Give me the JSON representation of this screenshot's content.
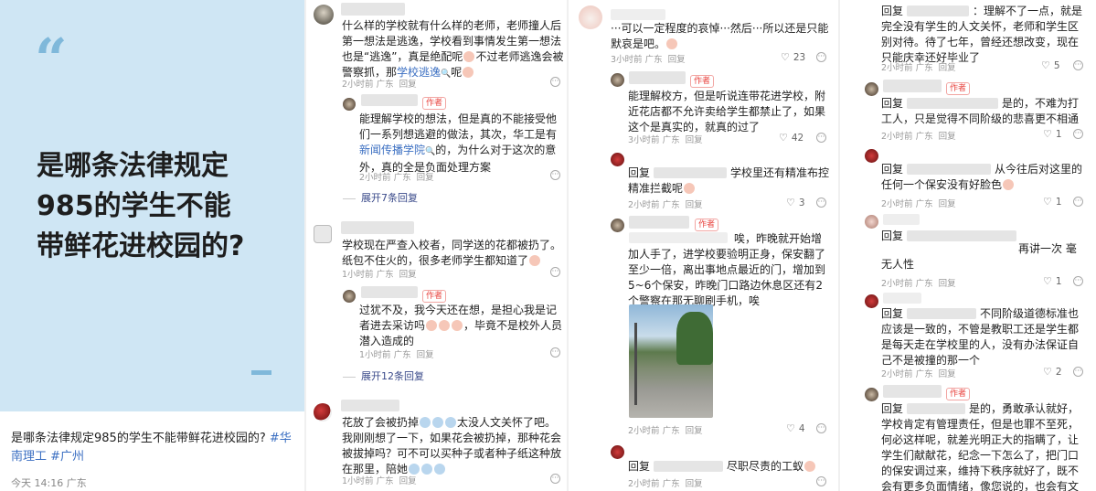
{
  "post": {
    "quote_mark": "“",
    "title_lines": [
      "是哪条法律规定",
      "985的学生不能",
      "带鲜花进校园的?"
    ],
    "caption_text": "是哪条法律规定985的学生不能带鲜花进校园的? ",
    "caption_tags": "#华南理工 #广州",
    "meta": "今天 14:16 广东"
  },
  "common": {
    "author_tag": "作者",
    "reply": "回复",
    "reply_prefix": "回复"
  },
  "col1": {
    "c1": {
      "text_a": "什么样的学校就有什么样的老师，老师撞人后第一想法是逃逸，学校看到事情发生第一想法也是“逃逸”，真是绝配呢",
      "text_b": "不过老师逃逸会被警察抓，那",
      "link": "学校逃逸",
      "link_icon": "🔍",
      "text_c": "呢",
      "meta": "2小时前 广东",
      "reply": "回复"
    },
    "c1r": {
      "text_a": "能理解学校的想法，但是真的不能接受他们一系列想逃避的做法，其次，华工是有",
      "link": "新闻传播学院",
      "link_icon": "🔍",
      "text_b": "的，为什么对于这次的意外，真的全是负面处理方案",
      "meta": "2小时前 广东",
      "reply": "回复"
    },
    "expand1": "展开7条回复",
    "c2": {
      "text": "学校现在严查入校者，同学送的花都被扔了。纸包不住火的，很多老师学生都知道了",
      "meta": "1小时前 广东",
      "reply": "回复"
    },
    "c2r": {
      "text_a": "过犹不及，我今天还在想，是担心我是记者进去采访吗",
      "text_b": "，毕竟不是校外人员潜入造成的",
      "meta": "1小时前 广东",
      "reply": "回复"
    },
    "expand2": "展开12条回复",
    "c3": {
      "text_a": "花放了会被扔掉",
      "text_b": "太没人文关怀了吧。我刚刚想了一下，如果花会被扔掉，那种花会被拔掉吗？可不可以买种子或者种子纸这种放在那里，陪她",
      "meta": "1小时前 广东",
      "reply": "回复"
    }
  },
  "col2": {
    "c1": {
      "text": "···可以一定程度的哀悼···然后···所以还是只能默哀是吧。",
      "meta": "3小时前 广东",
      "reply": "回复",
      "likes": "23"
    },
    "c2": {
      "text": "能理解校方，但是听说连带花进学校，附近花店都不允许卖给学生都禁止了，如果这个是真实的，就真的过了",
      "meta": "3小时前 广东",
      "reply": "回复",
      "likes": "42"
    },
    "c3": {
      "text_a": "学校里还有精准布控精准拦截呢",
      "meta": "2小时前 广东",
      "reply": "回复",
      "likes": "3"
    },
    "c4": {
      "text_a": "唉，昨晚就开始增加人手了，进学校要验明正身，保安翻了至少一倍，离出事地点最近的门，增加到5~6个保安，昨晚门口路边休息区还有2个警察在那无聊刷手机，唉",
      "meta": "2小时前 广东",
      "reply": "回复",
      "likes": "4"
    },
    "c5": {
      "text_a": "尽职尽责的工蚁",
      "meta": "2小时前 广东",
      "reply": "回复"
    }
  },
  "col3": {
    "c1": {
      "text": "：理解不了一点，就是完全没有学生的人文关怀，老师和学生区别对待。待了七年，曾经还想改变，现在只能庆幸还好毕业了",
      "meta": "2小时前 广东",
      "reply": "回复",
      "likes": "5"
    },
    "c2": {
      "text_a": "是的，不难为打工人，只是觉得不同阶级的悲喜更不相通",
      "meta": "2小时前 广东",
      "reply": "回复",
      "likes": "1"
    },
    "c3": {
      "text_a": "从今往后对这里的任何一个保安没有好脸色",
      "meta": "2小时前 广东",
      "reply": "回复",
      "likes": "1"
    },
    "c4": {
      "text_a": "再讲一次 毫无人性",
      "meta": "2小时前 广东",
      "reply": "回复",
      "likes": "1"
    },
    "c5": {
      "text_a": "不同阶级道德标准也应该是一致的，不管是教职工还是学生都是每天走在学校里的人，没有办法保证自己不是被撞的那一个",
      "meta": "2小时前 广东",
      "reply": "回复",
      "likes": "2"
    },
    "c6": {
      "text_a": "是的，勇敢承认就好，学校肯定有管理责任，但是也罪不至死，何必这样呢，就差光明正大的指瞒了，让学生们献献花，纪念一下怎么了，把门口的保安调过来，维持下秩序就好了，既不会有更多负面情绪，像您说的，也会有文人关怀及温暖"
    }
  }
}
